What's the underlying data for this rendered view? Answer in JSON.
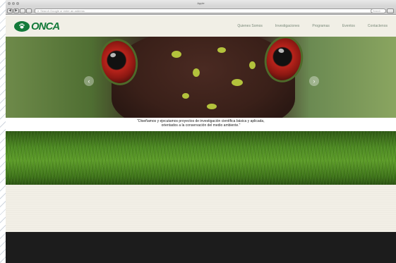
{
  "browser": {
    "window_title": "Apple",
    "url_placeholder": "Search Google or enter an address",
    "search_placeholder": "Search",
    "back_glyph": "◀",
    "forward_glyph": "▶"
  },
  "site": {
    "logo_text": "ONCA",
    "nav": [
      {
        "label": "Quienes Somos"
      },
      {
        "label": "Investigaciones"
      },
      {
        "label": "Programas"
      },
      {
        "label": "Eventos"
      },
      {
        "label": "Contactenos"
      }
    ],
    "hero": {
      "prev_glyph": "‹",
      "next_glyph": "›"
    },
    "caption": {
      "line1": "\"Diseñamos y ejecutamos proyectos de investigación científica básica y aplicada,",
      "line2": "orientados a la conservación del medio ambiente.\""
    }
  },
  "colors": {
    "brand_green": "#147a3a",
    "header_bg": "#f1efe6",
    "footer_bg": "#1c1c1c"
  },
  "icons": [
    "close-icon",
    "minimize-icon",
    "zoom-icon",
    "back-icon",
    "forward-icon",
    "search-icon",
    "paw-icon",
    "chevron-left-icon",
    "chevron-right-icon"
  ]
}
